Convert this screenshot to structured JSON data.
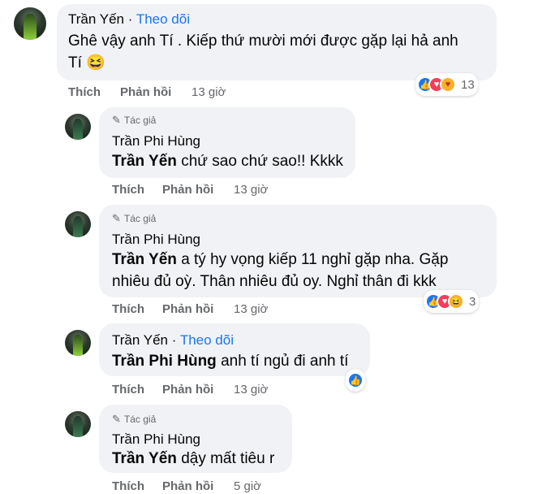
{
  "comments": [
    {
      "name": "Trần Yến",
      "follow": "Theo dõi",
      "line1": "Ghê vậy anh Tí . Kiếp thứ mười mới được gặp lại hả anh",
      "line2": "Tí",
      "line2_emoji": "😆",
      "like": "Thích",
      "reply": "Phản hồi",
      "time": "13 giờ",
      "reactions": [
        "like-icon",
        "love-icon",
        "care-icon"
      ],
      "reaction_count": "13"
    },
    {
      "author_tag": "Tác giả",
      "name": "Trần Phi Hùng",
      "mention": "Trần Yến",
      "text": "chứ sao chứ sao!! Kkkk",
      "like": "Thích",
      "reply": "Phản hồi",
      "time": "13 giờ"
    },
    {
      "author_tag": "Tác giả",
      "name": "Trần Phi Hùng",
      "mention": "Trần Yến",
      "line1": "a tý hy vọng kiếp 11 nghỉ gặp nha. Gặp",
      "line2": "nhiêu đủ oỳ. Thân nhiêu đủ oy. Nghỉ thân đi kkk",
      "like": "Thích",
      "reply": "Phản hồi",
      "time": "13 giờ",
      "reactions": [
        "like-icon",
        "love-icon",
        "haha-icon"
      ],
      "reaction_count": "3"
    },
    {
      "name": "Trần Yến",
      "follow": "Theo dõi",
      "mention": "Trần Phi Hùng",
      "text": "anh tí ngủ đi anh tí",
      "like": "Thích",
      "reply": "Phản hồi",
      "time": "13 giờ",
      "reactions": [
        "like-icon"
      ]
    },
    {
      "author_tag": "Tác giả",
      "name": "Trần Phi Hùng",
      "mention": "Trần Yến",
      "text": "dậy mất tiêu r",
      "like": "Thích",
      "reply": "Phản hồi",
      "time": "5 giờ"
    }
  ],
  "colors": {
    "bubble": "#f0f2f5",
    "link": "#1877f2",
    "muted": "#65676b"
  }
}
